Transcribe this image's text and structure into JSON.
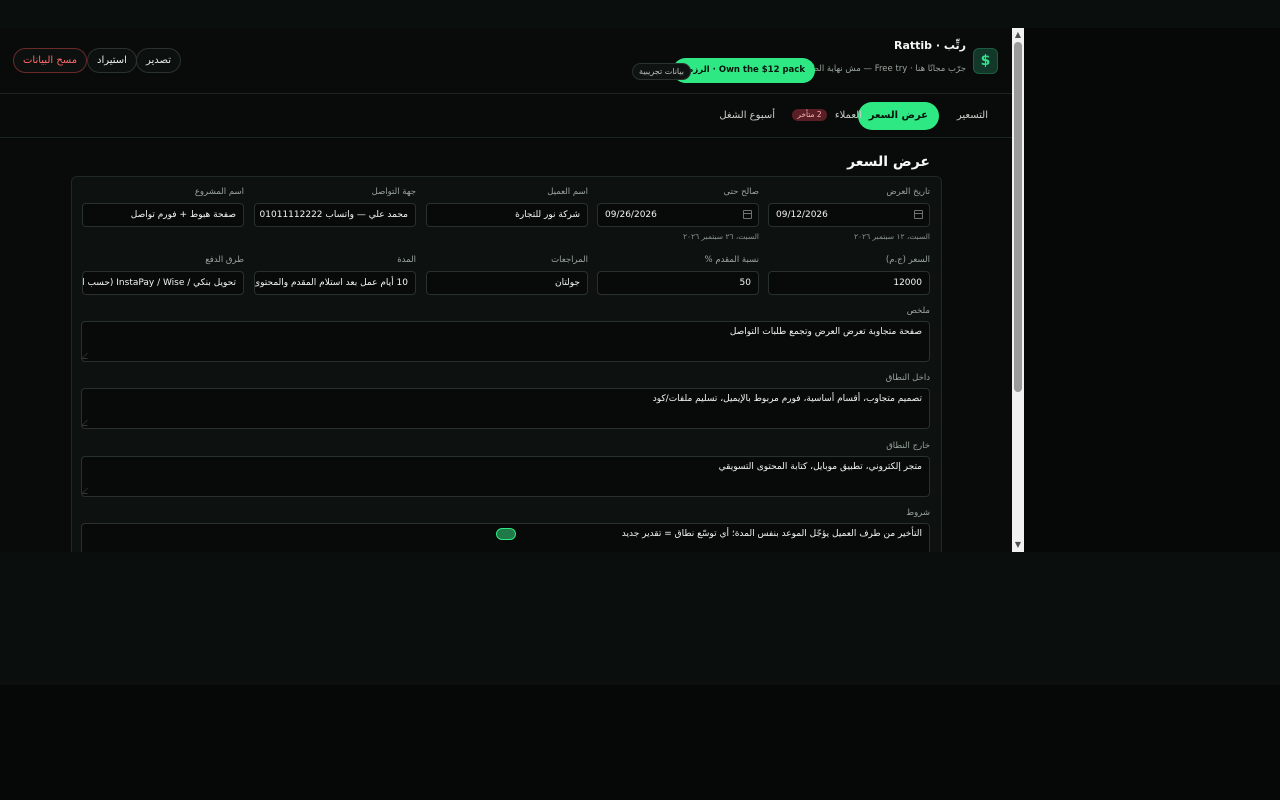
{
  "header": {
    "app_title": "رتِّب · Rattib",
    "tagline": "جرّب مجانًا هنا · Free try — مش نهاية الطريق",
    "cta_label": "Own the $12 pack · الرزمة",
    "demo_chip": "بيانات تجريبية",
    "brand_icon": "$",
    "export_label": "تصدير",
    "import_label": "استيراد",
    "clear_label": "مسح البيانات"
  },
  "tabs": {
    "pricing": "التسعير",
    "quote": "عرض السعر",
    "clients": "العملاء",
    "clients_badge": "2 متأخر",
    "week": "أسبوع الشغل",
    "active": "quote"
  },
  "section": {
    "title": "عرض السعر"
  },
  "form": {
    "offer_date": {
      "label": "تاريخ العرض",
      "value": "09/12/2026",
      "hint": "السبت، ١٢ سبتمبر ٢٠٢٦"
    },
    "valid_until": {
      "label": "صالح حتى",
      "value": "09/26/2026",
      "hint": "السبت، ٢٦ سبتمبر ٢٠٢٦"
    },
    "client_name": {
      "label": "اسم العميل",
      "value": "شركة نور للتجارة"
    },
    "contact": {
      "label": "جهة التواصل",
      "value": "محمد علي — واتساب 01011112222"
    },
    "project_name": {
      "label": "اسم المشروع",
      "value": "صفحة هبوط + فورم تواصل"
    },
    "price": {
      "label": "السعر (ج.م)",
      "value": "12000"
    },
    "deposit": {
      "label": "نسبة المقدم %",
      "value": "50"
    },
    "revisions": {
      "label": "المراجعات",
      "value": "جولتان"
    },
    "duration": {
      "label": "المدة",
      "value": "10 أيام عمل بعد استلام المقدم والمحتوى"
    },
    "payment": {
      "label": "طرق الدفع",
      "value": "تحويل بنكي / InstaPay / Wise (حسب الاتفاق)"
    },
    "summary": {
      "label": "ملخص",
      "value": "صفحة متجاوبة تعرض العرض وتجمع طلبات التواصل"
    },
    "in_scope": {
      "label": "داخل النطاق",
      "value": "تصميم متجاوب، أقسام أساسية، فورم مربوط بالإيميل، تسليم ملفات/كود"
    },
    "out_scope": {
      "label": "خارج النطاق",
      "value": "متجر إلكتروني، تطبيق موبايل، كتابة المحتوى التسويقي"
    },
    "terms": {
      "label": "شروط",
      "value": "التأخير من طرف العميل يؤجّل الموعد بنفس المدة؛ أي توسّع نطاق = تقدير جديد"
    }
  },
  "colors": {
    "accent": "#2ee883",
    "danger": "#ff6b6b",
    "background": "#080b09"
  }
}
